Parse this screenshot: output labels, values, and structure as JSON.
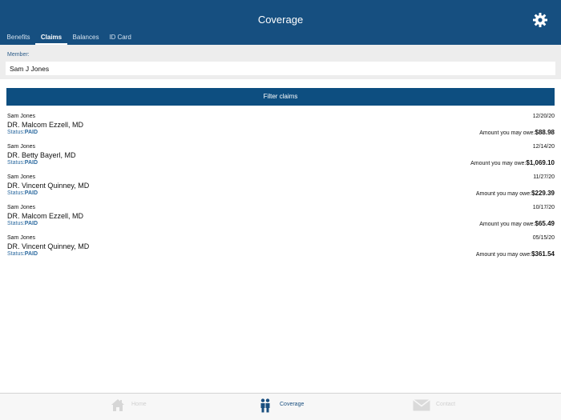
{
  "header": {
    "title": "Coverage",
    "settings_icon": "gear-icon"
  },
  "tabs": [
    {
      "label": "Benefits",
      "active": false
    },
    {
      "label": "Claims",
      "active": true
    },
    {
      "label": "Balances",
      "active": false
    },
    {
      "label": "ID Card",
      "active": false
    }
  ],
  "member": {
    "label": "Member:",
    "value": "Sam J Jones"
  },
  "filter": {
    "label": "Filter claims"
  },
  "claims": [
    {
      "member": "Sam Jones",
      "doctor": "DR. Malcom Ezzell, MD",
      "status_label": "Status:",
      "status": "PAID",
      "date": "12/20/20",
      "owe_label": "Amount you may owe:",
      "amount": "$88.98"
    },
    {
      "member": "Sam Jones",
      "doctor": "DR. Betty Bayerl, MD",
      "status_label": "Status:",
      "status": "PAID",
      "date": "12/14/20",
      "owe_label": "Amount you may owe:",
      "amount": "$1,069.10"
    },
    {
      "member": "Sam Jones",
      "doctor": "DR. Vincent Quinney, MD",
      "status_label": "Status:",
      "status": "PAID",
      "date": "11/27/20",
      "owe_label": "Amount you may owe:",
      "amount": "$229.39"
    },
    {
      "member": "Sam Jones",
      "doctor": "DR. Malcom Ezzell, MD",
      "status_label": "Status:",
      "status": "PAID",
      "date": "10/17/20",
      "owe_label": "Amount you may owe:",
      "amount": "$65.49"
    },
    {
      "member": "Sam Jones",
      "doctor": "DR. Vincent Quinney, MD",
      "status_label": "Status:",
      "status": "PAID",
      "date": "05/15/20",
      "owe_label": "Amount you may owe:",
      "amount": "$361.54"
    }
  ],
  "bottom_tabs": [
    {
      "label": "Home",
      "icon": "home-icon",
      "active": false
    },
    {
      "label": "Coverage",
      "icon": "family-icon",
      "active": true
    },
    {
      "label": "Contact",
      "icon": "mail-icon",
      "active": false
    }
  ],
  "colors": {
    "header": "#164f80",
    "accent": "#0d4e80",
    "status": "#2c6aa0"
  }
}
